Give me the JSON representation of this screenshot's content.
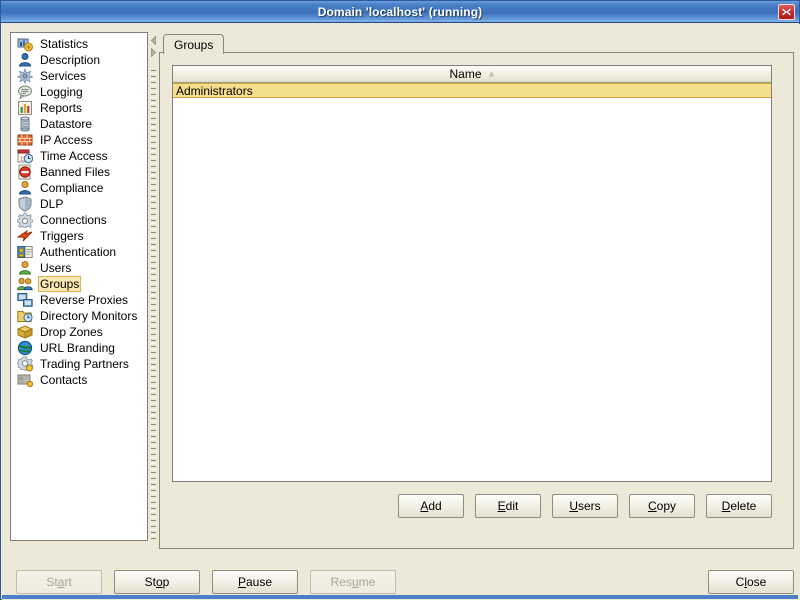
{
  "window": {
    "title": "Domain 'localhost' (running)",
    "close_icon": "close-icon"
  },
  "sidebar": {
    "items": [
      {
        "label": "Statistics",
        "icon": "statistics-icon",
        "selected": false
      },
      {
        "label": "Description",
        "icon": "description-icon",
        "selected": false
      },
      {
        "label": "Services",
        "icon": "services-icon",
        "selected": false
      },
      {
        "label": "Logging",
        "icon": "logging-icon",
        "selected": false
      },
      {
        "label": "Reports",
        "icon": "reports-icon",
        "selected": false
      },
      {
        "label": "Datastore",
        "icon": "datastore-icon",
        "selected": false
      },
      {
        "label": "IP Access",
        "icon": "ip-access-icon",
        "selected": false
      },
      {
        "label": "Time Access",
        "icon": "time-access-icon",
        "selected": false
      },
      {
        "label": "Banned Files",
        "icon": "banned-files-icon",
        "selected": false
      },
      {
        "label": "Compliance",
        "icon": "compliance-icon",
        "selected": false
      },
      {
        "label": "DLP",
        "icon": "dlp-icon",
        "selected": false
      },
      {
        "label": "Connections",
        "icon": "connections-icon",
        "selected": false
      },
      {
        "label": "Triggers",
        "icon": "triggers-icon",
        "selected": false
      },
      {
        "label": "Authentication",
        "icon": "authentication-icon",
        "selected": false
      },
      {
        "label": "Users",
        "icon": "users-icon",
        "selected": false
      },
      {
        "label": "Groups",
        "icon": "groups-icon",
        "selected": true
      },
      {
        "label": "Reverse Proxies",
        "icon": "reverse-proxies-icon",
        "selected": false
      },
      {
        "label": "Directory Monitors",
        "icon": "directory-monitors-icon",
        "selected": false
      },
      {
        "label": "Drop Zones",
        "icon": "drop-zones-icon",
        "selected": false
      },
      {
        "label": "URL Branding",
        "icon": "url-branding-icon",
        "selected": false
      },
      {
        "label": "Trading Partners",
        "icon": "trading-partners-icon",
        "selected": false
      },
      {
        "label": "Contacts",
        "icon": "contacts-icon",
        "selected": false
      }
    ]
  },
  "divider": {
    "collapse_up_icon": "triangle-left-icon",
    "collapse_down_icon": "triangle-right-icon"
  },
  "tabs": [
    {
      "label": "Groups",
      "active": true
    }
  ],
  "table": {
    "columns": [
      {
        "label": "Name",
        "sort": "ascending",
        "sort_icon": "sort-ascending-icon"
      }
    ],
    "rows": [
      {
        "name": "Administrators",
        "selected": true
      }
    ]
  },
  "actions": [
    {
      "label": "Add",
      "mnemonic": "A",
      "enabled": true
    },
    {
      "label": "Edit",
      "mnemonic": "E",
      "enabled": true
    },
    {
      "label": "Users",
      "mnemonic": "U",
      "enabled": true
    },
    {
      "label": "Copy",
      "mnemonic": "C",
      "enabled": true
    },
    {
      "label": "Delete",
      "mnemonic": "D",
      "enabled": true
    }
  ],
  "bottom": {
    "left_buttons": [
      {
        "label": "Start",
        "mnemonic": "a",
        "enabled": false
      },
      {
        "label": "Stop",
        "mnemonic": "o",
        "enabled": true
      },
      {
        "label": "Pause",
        "mnemonic": "P",
        "enabled": true
      },
      {
        "label": "Resume",
        "mnemonic": "u",
        "enabled": false
      }
    ],
    "right_buttons": [
      {
        "label": "Close",
        "mnemonic": "l",
        "enabled": true
      }
    ]
  },
  "colors": {
    "titlebar_blue": "#3d71ba",
    "panel_bg": "#ece9d8",
    "selection_gold": "#f5de8c",
    "nav_selected_bg": "#fbe8b0",
    "close_red": "#c52f2f"
  }
}
